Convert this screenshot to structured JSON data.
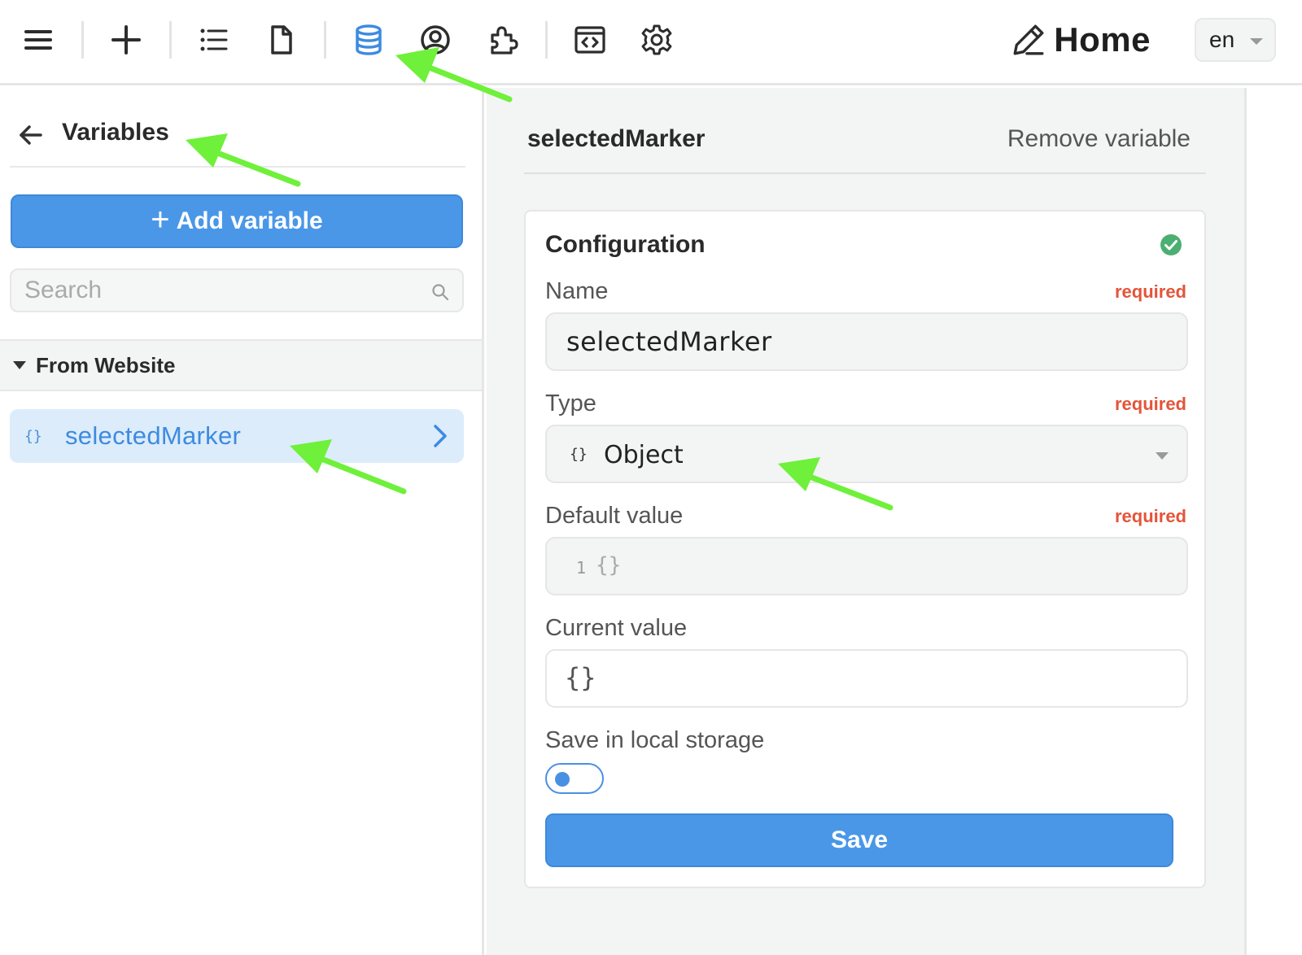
{
  "toolbar": {
    "icons": [
      "menu-icon",
      "plus-icon",
      "list-icon",
      "file-icon",
      "database-icon",
      "user-circle-icon",
      "puzzle-icon",
      "code-window-icon",
      "gear-icon"
    ],
    "active_color": "#3d8be0",
    "page_title": "Home",
    "language": "en"
  },
  "sidebar": {
    "title": "Variables",
    "add_button": "Add variable",
    "search_placeholder": "Search",
    "group_title": "From Website",
    "items": [
      {
        "braces": "{}",
        "label": "selectedMarker"
      }
    ]
  },
  "editor": {
    "variable_name": "selectedMarker",
    "remove_label": "Remove variable",
    "card_title": "Configuration",
    "status": "valid",
    "fields": {
      "name_label": "Name",
      "name_required": "required",
      "name_value": "selectedMarker",
      "type_label": "Type",
      "type_required": "required",
      "type_braces": "{}",
      "type_value": "Object",
      "default_label": "Default value",
      "default_required": "required",
      "default_line_no": "1",
      "default_value": "{}",
      "current_label": "Current value",
      "current_value": "{}",
      "local_storage_label": "Save in local storage",
      "local_storage_enabled": false
    },
    "save_label": "Save"
  },
  "colors": {
    "primary": "#4a97e8",
    "required": "#e3553a",
    "success": "#4caf72",
    "annotation_arrow": "#6ff03a"
  }
}
